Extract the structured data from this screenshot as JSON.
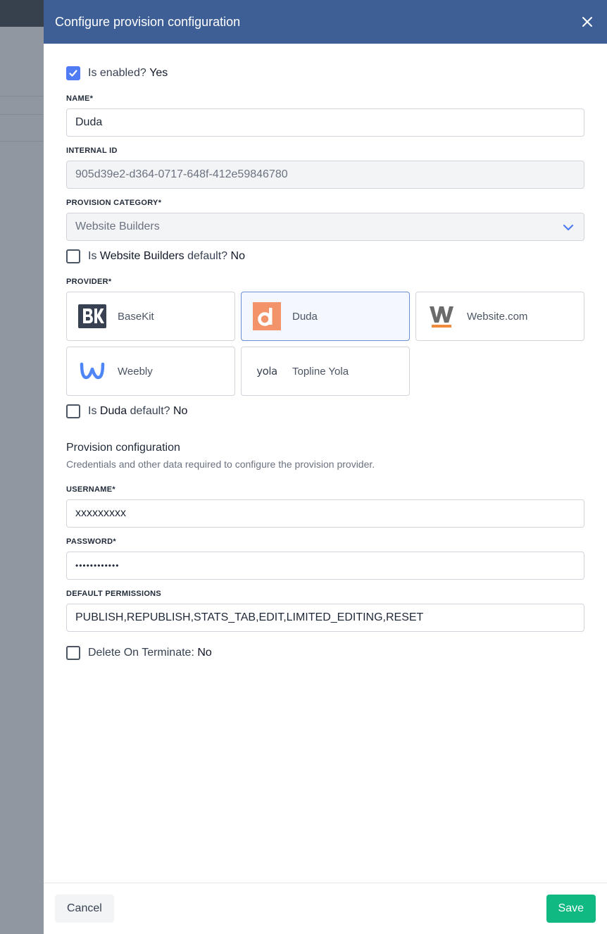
{
  "panel": {
    "title": "Configure provision configuration"
  },
  "enabled": {
    "label": "Is enabled?",
    "value": "Yes",
    "checked": true
  },
  "fields": {
    "name": {
      "label": "NAME*",
      "value": "Duda"
    },
    "internal_id": {
      "label": "INTERNAL ID",
      "value": "905d39e2-d364-0717-648f-412e59846780"
    },
    "category": {
      "label": "PROVISION CATEGORY*",
      "value": "Website Builders"
    }
  },
  "category_default": {
    "prefix": "Is",
    "category": "Website Builders",
    "suffix": "default?",
    "value": "No"
  },
  "provider": {
    "label": "PROVIDER*",
    "items": [
      {
        "name": "BaseKit",
        "logo": "basekit-logo"
      },
      {
        "name": "Duda",
        "logo": "duda-logo",
        "selected": true
      },
      {
        "name": "Website.com",
        "logo": "websitecom-logo"
      },
      {
        "name": "Weebly",
        "logo": "weebly-logo"
      },
      {
        "name": "Topline Yola",
        "logo": "yola-logo",
        "logo_text": "yola"
      }
    ]
  },
  "provider_default": {
    "prefix": "Is",
    "provider": "Duda",
    "suffix": "default?",
    "value": "No"
  },
  "provision_config": {
    "title": "Provision configuration",
    "description": "Credentials and other data required to configure the provision provider.",
    "username": {
      "label": "USERNAME*",
      "value": "xxxxxxxxx"
    },
    "password": {
      "label": "PASSWORD*",
      "value": "••••••••••••"
    },
    "permissions": {
      "label": "DEFAULT PERMISSIONS",
      "value": "PUBLISH,REPUBLISH,STATS_TAB,EDIT,LIMITED_EDITING,RESET"
    }
  },
  "delete_on_terminate": {
    "label": "Delete On Terminate:",
    "value": "No"
  },
  "footer": {
    "cancel_label": "Cancel",
    "save_label": "Save"
  },
  "colors": {
    "header": "#3e5f95",
    "accent": "#4f7cf3",
    "save": "#10b981"
  }
}
